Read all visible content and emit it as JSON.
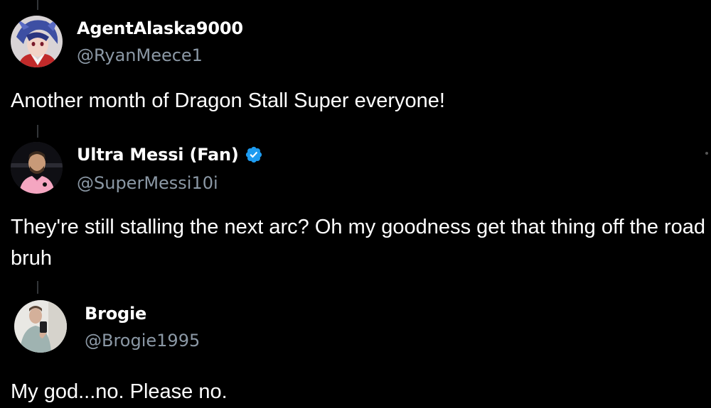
{
  "tweets": [
    {
      "display_name": "AgentAlaska9000",
      "handle": "@RyanMeece1",
      "text": "Another month of Dragon Stall Super everyone!",
      "verified": false,
      "avatar": "anime-character-avatar"
    },
    {
      "display_name": "Ultra Messi (Fan)",
      "handle": "@SuperMessi10i",
      "text": "They're still stalling the next arc? Oh my goodness get that thing off the road bruh",
      "verified": true,
      "avatar": "soccer-player-avatar"
    },
    {
      "display_name": "Brogie",
      "handle": "@Brogie1995",
      "text": "My god...no. Please no.",
      "verified": false,
      "avatar": "mirror-selfie-avatar"
    }
  ],
  "colors": {
    "background": "#000000",
    "text": "#ffffff",
    "handle": "#8b98a5",
    "thread_line": "#333639",
    "verified": "#1d9bf0"
  }
}
